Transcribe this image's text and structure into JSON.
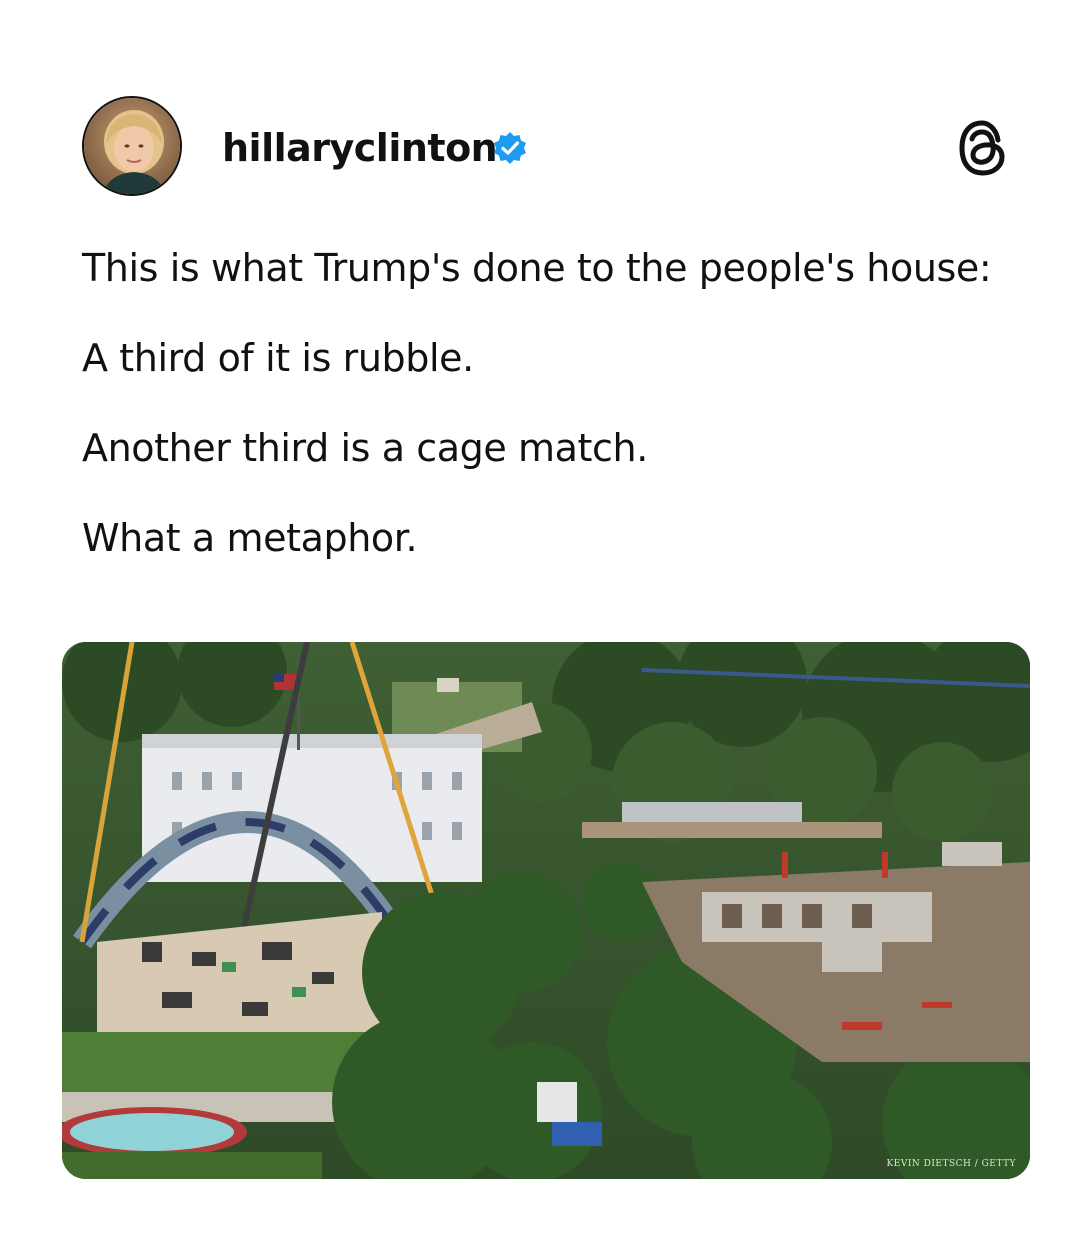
{
  "post": {
    "author": {
      "username": "hillaryclinton",
      "verified": true,
      "avatar_icon": "profile-photo",
      "verified_icon": "verified-badge-icon",
      "verified_color": "#1d9bf0"
    },
    "app_logo_icon": "threads-logo-icon",
    "text_lines": [
      "This is what Trump's done to the people's house:",
      "A third of it is rubble.",
      "Another third is a cage match.",
      "What a metaphor."
    ],
    "photo": {
      "credit": "KEVIN DIETSCH / GETTY"
    }
  }
}
